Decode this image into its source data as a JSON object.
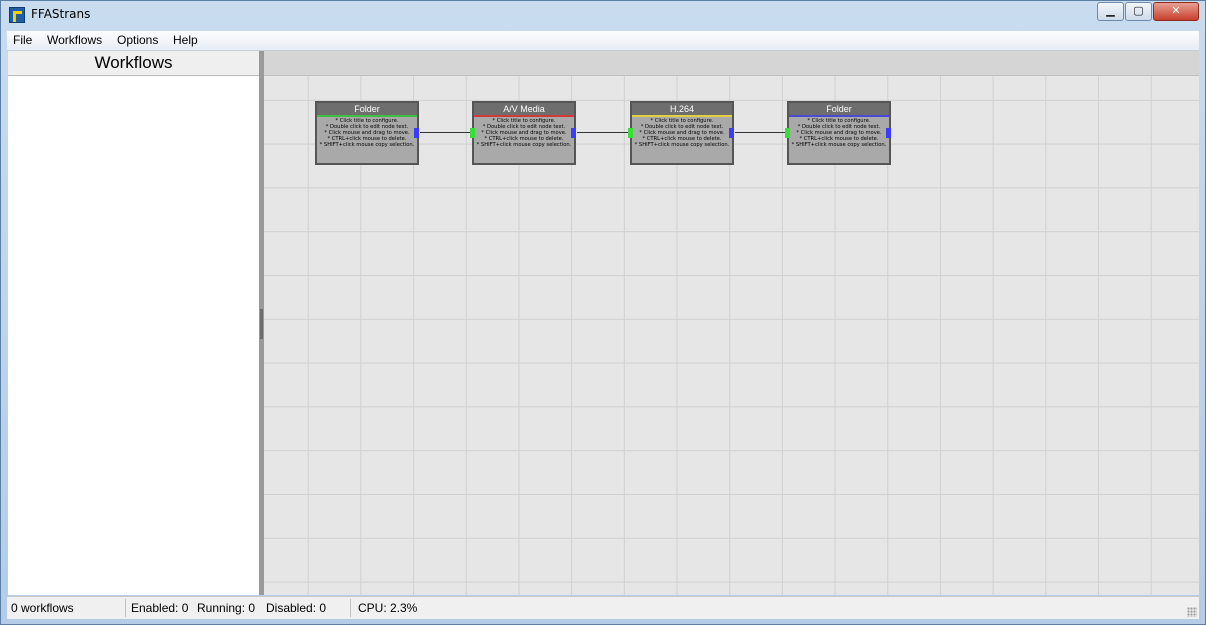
{
  "window": {
    "title": "FFAStrans"
  },
  "menu": [
    "File",
    "Workflows",
    "Options",
    "Help"
  ],
  "left_panel": {
    "header": "Workflows"
  },
  "node_help_text": "* Click title to configure.\n* Double click to edit node text.\n* Click mouse and drag to move.\n* CTRL+click mouse to delete.\n* SHIFT+click mouse copy selection.",
  "nodes": [
    {
      "title": "Folder",
      "accent_color": "#3fbf3f"
    },
    {
      "title": "A/V Media",
      "accent_color": "#d23a3a"
    },
    {
      "title": "H.264",
      "accent_color": "#e0d040"
    },
    {
      "title": "Folder",
      "accent_color": "#4a4ad6"
    }
  ],
  "status": {
    "workflows": "0 workflows",
    "enabled": "Enabled: 0",
    "running": "Running: 0",
    "disabled": "Disabled: 0",
    "cpu": "CPU: 2.3%"
  },
  "colors": {
    "port_in": "#37e037",
    "port_out": "#3b3bff"
  }
}
